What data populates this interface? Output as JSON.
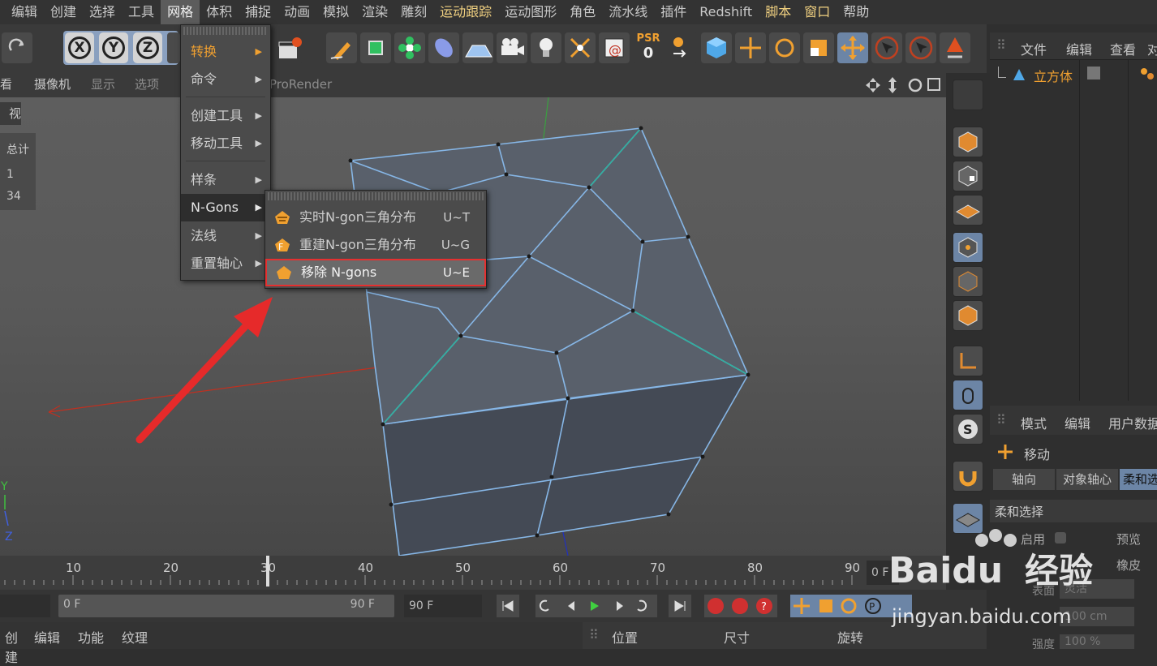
{
  "menubar": [
    "编辑",
    "创建",
    "选择",
    "工具",
    "网格",
    "体积",
    "捕捉",
    "动画",
    "模拟",
    "渲染",
    "雕刻",
    "运动跟踪",
    "运动图形",
    "角色",
    "流水线",
    "插件",
    "Redshift",
    "脚本",
    "窗口",
    "帮助"
  ],
  "menubar_active": "网格",
  "toolbar": {
    "axis_x": "X",
    "axis_y": "Y",
    "axis_z": "Z",
    "psr_label": "PSR",
    "psr_value": "0"
  },
  "viewport_bar": [
    "查看",
    "摄像机",
    "显示",
    "选项",
    "ProRender"
  ],
  "viewport_bar_partial_first": "看",
  "stats": {
    "title_partial": "视图",
    "header": "总计",
    "objects": "1",
    "points": "34"
  },
  "axis_gizmo": {
    "y": "Y",
    "z": "Z"
  },
  "mesh_menu": {
    "items": [
      {
        "label": "转换",
        "has_sub": true
      },
      {
        "label": "命令",
        "has_sub": true
      },
      {
        "label": "创建工具",
        "has_sub": true
      },
      {
        "label": "移动工具",
        "has_sub": true
      },
      {
        "label": "样条",
        "has_sub": true
      },
      {
        "label": "N-Gons",
        "has_sub": true
      },
      {
        "label": "法线",
        "has_sub": true
      },
      {
        "label": "重置轴心",
        "has_sub": true
      }
    ]
  },
  "ngons_submenu": {
    "items": [
      {
        "label": "实时N-gon三角分布",
        "shortcut": "U~T"
      },
      {
        "label": "重建N-gon三角分布",
        "shortcut": "U~G"
      },
      {
        "label": "移除 N-gons",
        "shortcut": "U~E"
      }
    ]
  },
  "object_manager": {
    "tabs": [
      "文件",
      "编辑",
      "查看",
      "对"
    ],
    "object": "立方体"
  },
  "attribute_manager": {
    "tabs": [
      "模式",
      "编辑",
      "用户数据"
    ],
    "tool": "移动",
    "subtabs": [
      "轴向",
      "对象轴心",
      "柔和选择"
    ],
    "section": "柔和选择",
    "enable": "启用",
    "preview": "预览",
    "rubber": "橡皮",
    "mode_label": "表面",
    "mode_value": "灵活",
    "radius_value": "100 cm",
    "strength_label": "强度",
    "strength_value": "100 %"
  },
  "timeline": {
    "ticks": [
      "10",
      "20",
      "30",
      "40",
      "50",
      "60",
      "70",
      "80",
      "90"
    ],
    "frame_field": "0 F"
  },
  "timectrl": {
    "start": "0 F",
    "end": "90 F",
    "end2": "90 F"
  },
  "bottom_bar": [
    "创建",
    "编辑",
    "功能",
    "纹理"
  ],
  "coords_bar": [
    "位置",
    "尺寸",
    "旋转"
  ],
  "watermark": {
    "brand": "Baidu",
    "cn": "经验",
    "url": "jingyan.baidu.com"
  },
  "colors": {
    "accent_orange": "#f0a030",
    "highlight_red": "#e53030",
    "mesh_edge": "#7fb0e0",
    "arrow": "#e62a2a"
  }
}
